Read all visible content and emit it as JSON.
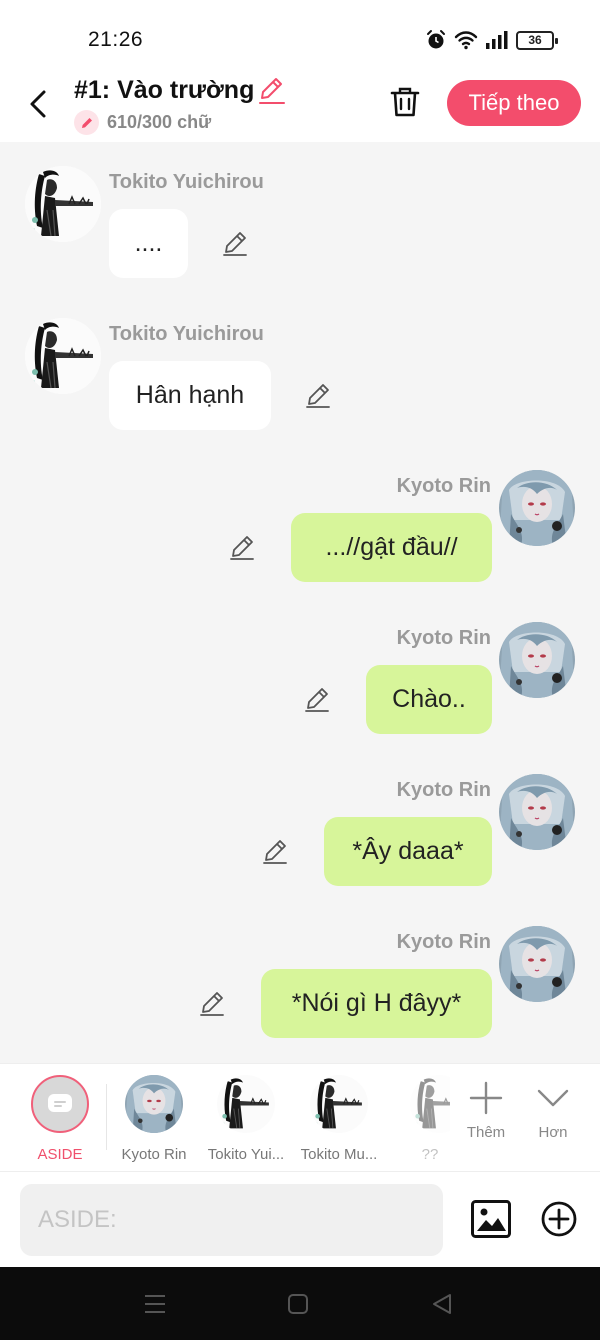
{
  "status_bar": {
    "time": "21:26",
    "battery": "36"
  },
  "header": {
    "title": "#1: Vào trường",
    "word_count": "610/300 chữ",
    "next_label": "Tiếp theo"
  },
  "messages": [
    {
      "side": "left",
      "sender": "Tokito Yuichirou",
      "text": "....",
      "avatar": "tokito-avatar"
    },
    {
      "side": "left",
      "sender": "Tokito Yuichirou",
      "text": "Hân hạnh",
      "avatar": "tokito-avatar"
    },
    {
      "side": "right",
      "sender": "Kyoto Rin",
      "text": "...//gật đầu//",
      "avatar": "kyoto-avatar"
    },
    {
      "side": "right",
      "sender": "Kyoto Rin",
      "text": "Chào..",
      "avatar": "kyoto-avatar"
    },
    {
      "side": "right",
      "sender": "Kyoto Rin",
      "text": "*Ây daaa*",
      "avatar": "kyoto-avatar"
    },
    {
      "side": "right",
      "sender": "Kyoto Rin",
      "text": "*Nói gì H đâyy*",
      "avatar": "kyoto-avatar"
    }
  ],
  "picker": {
    "aside_label": "ASIDE",
    "characters": [
      {
        "label": "Kyoto Rin"
      },
      {
        "label": "Tokito Yui..."
      },
      {
        "label": "Tokito Mu..."
      },
      {
        "label": "??"
      }
    ],
    "more_label": "Thêm",
    "expand_label": "Hơn"
  },
  "input": {
    "placeholder": "ASIDE:"
  },
  "colors": {
    "accent": "#f34d6c",
    "bubble_right": "#d7f59a",
    "bubble_left": "#ffffff",
    "background": "#f5f5f5"
  }
}
